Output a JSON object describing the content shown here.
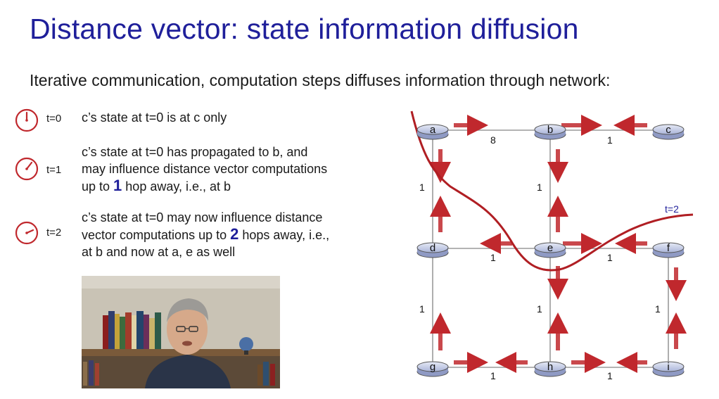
{
  "title": "Distance vector: state information diffusion",
  "subtitle": "Iterative communication, computation steps diffuses information through network:",
  "steps": [
    {
      "t": "t=0",
      "line1": "c’s state at t=0 is at c only"
    },
    {
      "t": "t=1",
      "line1": "c’s state at t=0 has propagated to b, and",
      "line2": "may influence distance vector computations",
      "line3_pre": "up to ",
      "line3_num": "1",
      "line3_post": " hop away, i.e., at b"
    },
    {
      "t": "t=2",
      "line1": "c’s state at t=0 may now influence distance",
      "line2_pre": "vector computations up to ",
      "line2_num": "2",
      "line2_post": " hops away, i.e.,",
      "line3": "at b and now at a, e as well"
    }
  ],
  "diagram": {
    "nodes": [
      "a",
      "b",
      "c",
      "d",
      "e",
      "f",
      "g",
      "h",
      "i"
    ],
    "weights": {
      "ab": "8",
      "bc": "1",
      "de": "1",
      "ef": "1",
      "gh": "1",
      "hi": "1",
      "ad": "1",
      "be": "1",
      "dg": "1",
      "eh": "1",
      "fi": "1"
    },
    "boundary_label": "t=2"
  },
  "colors": {
    "title": "#1f1f9a",
    "arrow": "#c0282d",
    "boundary": "#b01e23",
    "router": "#9aa6cf"
  }
}
